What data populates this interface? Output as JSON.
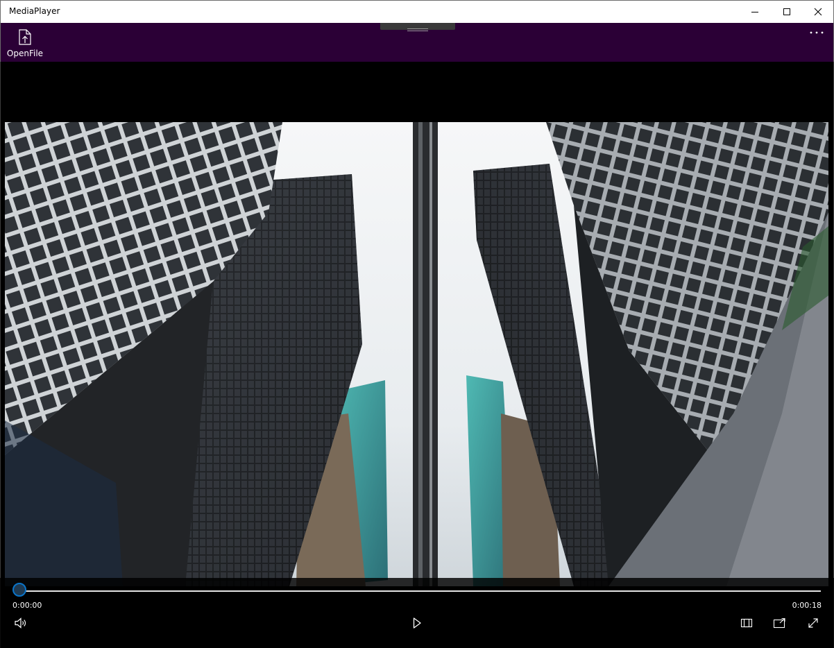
{
  "window": {
    "title": "MediaPlayer",
    "controls": [
      "minimize-icon",
      "maximize-icon",
      "close-icon"
    ]
  },
  "appbar": {
    "open_file_label": "OpenFile",
    "open_file_icon": "document-upload-icon",
    "more_icon": "more-ellipsis-icon",
    "background": "#2b0036"
  },
  "player": {
    "position_label": "0:00:00",
    "duration_label": "0:00:18",
    "progress": 0.0,
    "accent": "#0078d7",
    "buttons": [
      "volume-icon",
      "play-icon",
      "zoom-fit-icon",
      "cast-icon",
      "fullscreen-icon"
    ]
  }
}
